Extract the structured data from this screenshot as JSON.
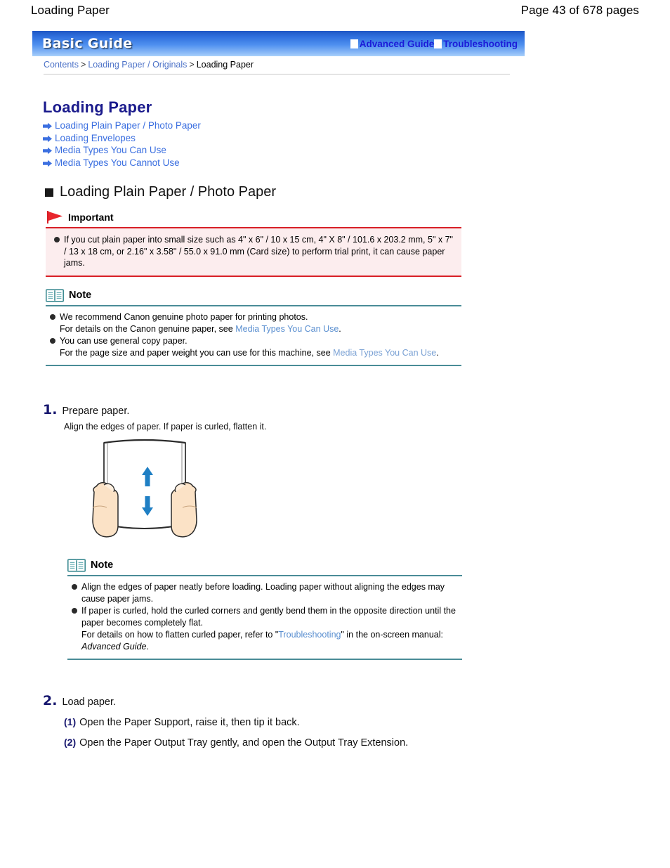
{
  "page_header": {
    "left_title": "Loading Paper",
    "right_pager": "Page 43 of 678 pages"
  },
  "banner": {
    "title": "Basic Guide",
    "links": [
      {
        "label": "Advanced Guide",
        "icon": "white-square-icon"
      },
      {
        "label": "Troubleshooting",
        "icon": "white-square-icon"
      }
    ],
    "accent_color": "#2f6fdd",
    "link_color": "#1c1cd8"
  },
  "breadcrumb": {
    "items": [
      {
        "label": "Contents",
        "link": true
      },
      {
        "label": "Loading Paper / Originals",
        "link": true
      },
      {
        "label": "Loading Paper",
        "link": false
      }
    ],
    "separator": ">"
  },
  "heading": {
    "title": "Loading Paper",
    "color": "#1a1a8c"
  },
  "toc_links": [
    {
      "label": "Loading Plain Paper / Photo Paper",
      "icon": "arrow-right-icon"
    },
    {
      "label": "Loading Envelopes",
      "icon": "arrow-right-icon"
    },
    {
      "label": "Media Types You Can Use",
      "icon": "arrow-right-icon"
    },
    {
      "label": "Media Types You Cannot Use",
      "icon": "arrow-right-icon"
    }
  ],
  "section": {
    "title": "Loading Plain Paper / Photo Paper"
  },
  "important": {
    "label": "Important",
    "icon": "red-flag-icon",
    "border_color": "#d81f26",
    "background_color": "#fcedee",
    "items": [
      "If you cut plain paper into small size such as 4\" x 6\" / 10 x 15 cm, 4\" X 8\" / 101.6 x 203.2 mm, 5\" x 7\" / 13 x 18 cm, or 2.16\" x 3.58\" / 55.0 x 91.0 mm (Card size) to perform trial print, it can cause paper jams."
    ]
  },
  "note1": {
    "label": "Note",
    "icon": "open-book-icon",
    "border_color": "#4a8c97",
    "items": [
      {
        "main": "We recommend Canon genuine photo paper for printing photos.",
        "sub_prefix": "For details on the Canon genuine paper, see",
        "sub_link": "Media Types You Can Use",
        "sub_suffix": "."
      },
      {
        "main": "You can use general copy paper.",
        "sub_prefix": "For the page size and paper weight you can use for this machine, see",
        "sub_link": "Media Types You Can Use",
        "sub_suffix": "."
      }
    ]
  },
  "step1": {
    "number": "1.",
    "title": "Prepare paper.",
    "subtitle": "Align the edges of paper. If paper is curled, flatten it.",
    "illustration": "hands-flattening-paper-stack-illustration"
  },
  "note2": {
    "label": "Note",
    "icon": "open-book-icon",
    "border_color": "#4a8c97",
    "items": [
      {
        "main": "Align the edges of paper neatly before loading. Loading paper without aligning the edges may cause paper jams."
      },
      {
        "main": "If paper is curled, hold the curled corners and gently bend them in the opposite direction until the paper becomes completely flat.",
        "sub_prefix": "For details on how to flatten curled paper, refer to \"",
        "sub_link": "Troubleshooting",
        "sub_suffix": "\" in the on-screen manual:",
        "sub_italic": "Advanced Guide",
        "sub_end": "."
      }
    ]
  },
  "step2": {
    "number": "2.",
    "title": "Load paper.",
    "substeps": [
      {
        "num": "(1)",
        "text": "Open the Paper Support, raise it, then tip it back."
      },
      {
        "num": "(2)",
        "text": "Open the Paper Output Tray gently, and open the Output Tray Extension."
      }
    ]
  }
}
